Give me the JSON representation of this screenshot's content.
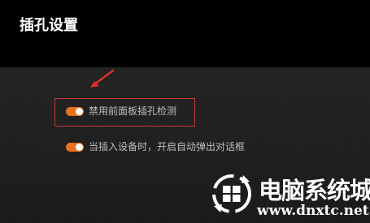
{
  "window": {
    "title": "插孔设置"
  },
  "settings": [
    {
      "label": "禁用前面板插孔检测",
      "enabled": true,
      "highlighted": true
    },
    {
      "label": "当插入设备时，开启自动弹出对话框",
      "enabled": true,
      "highlighted": false
    }
  ],
  "annotation": {
    "arrow_color": "#d8362a",
    "box_color": "#c23a2e"
  },
  "watermark": {
    "name": "电脑系统城",
    "url": "www.dnxtc.net"
  },
  "colors": {
    "header_bg": "#000000",
    "content_bg": "#1e1e1e",
    "toggle_on": "#e8731f",
    "text": "#bdbdbd"
  }
}
